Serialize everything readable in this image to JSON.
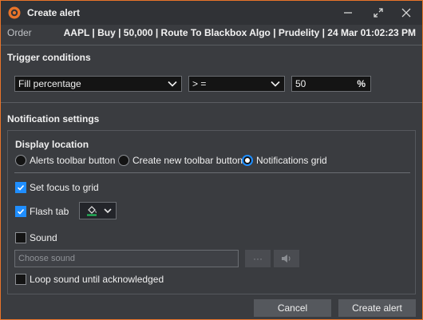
{
  "window": {
    "title": "Create alert"
  },
  "order": {
    "label": "Order",
    "value": "AAPL | Buy | 50,000 | Route To Blackbox Algo | Prudelity | 24 Mar 01:02:23 PM"
  },
  "trigger": {
    "title": "Trigger conditions",
    "field": "Fill percentage",
    "operator": "> =",
    "value": "50",
    "unit": "%"
  },
  "notification": {
    "title": "Notification settings",
    "display_location": {
      "label": "Display location",
      "options": [
        {
          "label": "Alerts toolbar button",
          "selected": false
        },
        {
          "label": "Create new toolbar button",
          "selected": false
        },
        {
          "label": "Notifications grid",
          "selected": true
        }
      ]
    },
    "set_focus": {
      "label": "Set focus to grid",
      "checked": true
    },
    "flash_tab": {
      "label": "Flash tab",
      "checked": true
    },
    "sound": {
      "label": "Sound",
      "checked": false,
      "placeholder": "Choose sound",
      "browse_label": "···"
    },
    "loop_sound": {
      "label": "Loop sound until acknowledged",
      "checked": false
    }
  },
  "buttons": {
    "cancel": "Cancel",
    "create": "Create alert"
  },
  "colors": {
    "accent": "#1f8eff",
    "border": "#e8742a",
    "flash": "#22c55e"
  }
}
